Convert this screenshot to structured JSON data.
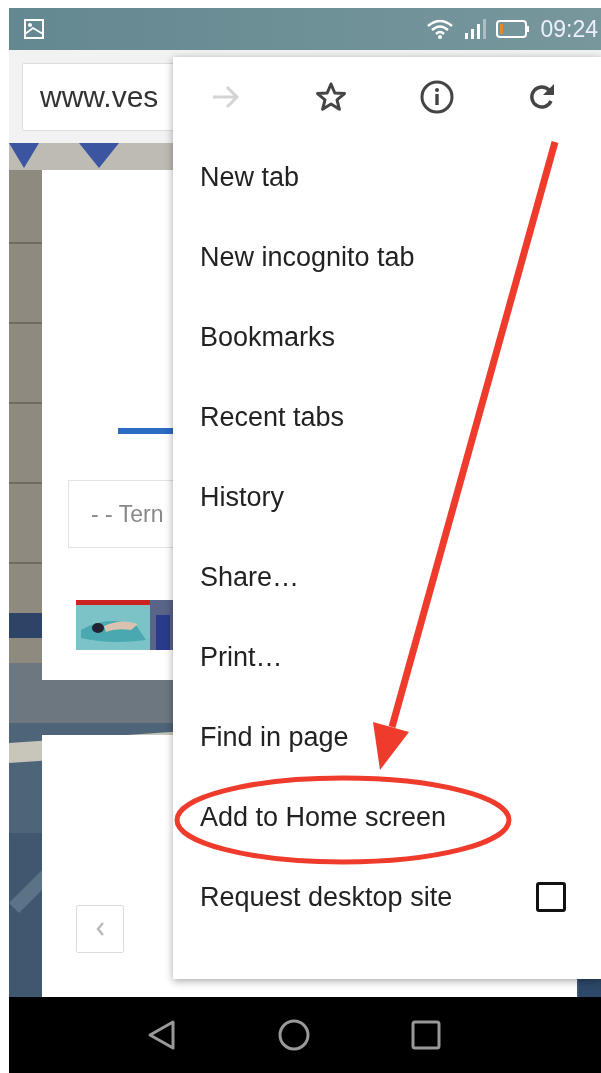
{
  "status_bar": {
    "time": "09:24"
  },
  "address_bar": {
    "url": "www.ves"
  },
  "page": {
    "dropdown": {
      "value": "- - Tern"
    }
  },
  "menu": {
    "actions": [
      {
        "kind": "forward",
        "disabled": true
      },
      {
        "kind": "star",
        "disabled": false
      },
      {
        "kind": "info",
        "disabled": false
      },
      {
        "kind": "reload",
        "disabled": false
      }
    ],
    "items": [
      {
        "kind": "plain",
        "label": "New tab",
        "circled": false
      },
      {
        "kind": "plain",
        "label": "New incognito tab",
        "circled": false
      },
      {
        "kind": "plain",
        "label": "Bookmarks",
        "circled": false
      },
      {
        "kind": "plain",
        "label": "Recent tabs",
        "circled": false
      },
      {
        "kind": "plain",
        "label": "History",
        "circled": false
      },
      {
        "kind": "plain",
        "label": "Share…",
        "circled": false
      },
      {
        "kind": "plain",
        "label": "Print…",
        "circled": false
      },
      {
        "kind": "plain",
        "label": "Find in page",
        "circled": false
      },
      {
        "kind": "plain",
        "label": "Add to Home screen",
        "circled": true
      },
      {
        "kind": "checkbox",
        "label": "Request desktop site",
        "checked": false,
        "circled": false
      }
    ]
  }
}
